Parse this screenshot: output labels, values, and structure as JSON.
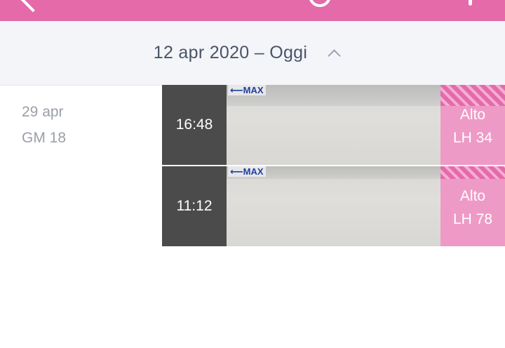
{
  "colors": {
    "accent": "#e46aa9",
    "result_bg": "#ee9ac6",
    "time_bg": "#4b4b4b",
    "range_bar_bg": "#f3f5f9"
  },
  "header": {
    "icons": [
      "back-icon",
      "circle-icon",
      "settings-icon"
    ]
  },
  "date_range": {
    "label": "12 apr 2020 – Oggi",
    "toggle_icon": "chevron-up-icon"
  },
  "day": {
    "date": "29 apr",
    "cycle_day": "GM 18"
  },
  "tests": [
    {
      "time": "16:48",
      "strip_mark": "⟵MAX",
      "result": "Alto",
      "lh": "LH 34"
    },
    {
      "time": "11:12",
      "strip_mark": "⟵MAX",
      "result": "Alto",
      "lh": "LH 78"
    }
  ]
}
